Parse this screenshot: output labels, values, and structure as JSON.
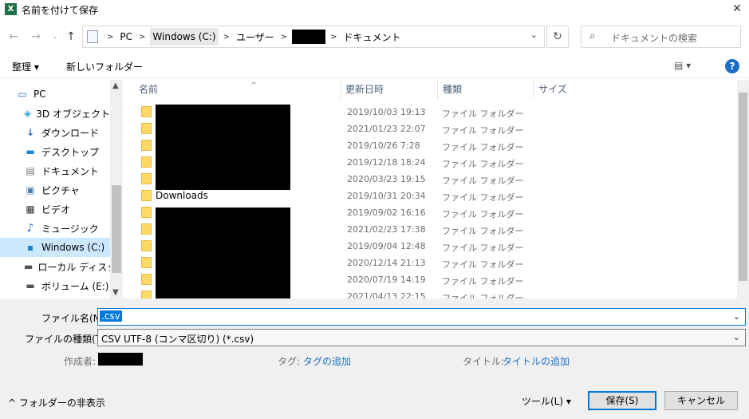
{
  "window": {
    "title": "名前を付けて保存",
    "app_icon_letter": "X",
    "close": "✕"
  },
  "nav": {
    "back": "←",
    "forward": "→",
    "recent": "⌄",
    "up": "↑",
    "refresh": "↻",
    "dropdown": "⌄"
  },
  "breadcrumbs": [
    "PC",
    "Windows (C:)",
    "ユーザー",
    "ドキュメント"
  ],
  "search": {
    "placeholder": "ドキュメントの検索",
    "icon": "⌕"
  },
  "toolbar": {
    "organize": "整理 ▾",
    "new_folder": "新しいフォルダー",
    "view": "▤ ▾",
    "help": "?"
  },
  "sidebar": {
    "items": [
      {
        "label": "PC",
        "icon": "pc-icon",
        "glyph": "▭"
      },
      {
        "label": "3D オブジェクト",
        "icon": "3d-objects-icon",
        "glyph": "◈"
      },
      {
        "label": "ダウンロード",
        "icon": "download-icon",
        "glyph": "↓"
      },
      {
        "label": "デスクトップ",
        "icon": "desktop-icon",
        "glyph": "▬"
      },
      {
        "label": "ドキュメント",
        "icon": "documents-icon",
        "glyph": "▤"
      },
      {
        "label": "ピクチャ",
        "icon": "pictures-icon",
        "glyph": "▣"
      },
      {
        "label": "ビデオ",
        "icon": "videos-icon",
        "glyph": "▦"
      },
      {
        "label": "ミュージック",
        "icon": "music-icon",
        "glyph": "♪"
      },
      {
        "label": "Windows (C:)",
        "icon": "drive-icon",
        "glyph": "▪"
      },
      {
        "label": "ローカル ディスク (D",
        "icon": "drive-icon",
        "glyph": "▬"
      },
      {
        "label": "ボリューム (E:)",
        "icon": "drive-icon",
        "glyph": "▬"
      }
    ],
    "selected_index": 8
  },
  "columns": {
    "name": "名前",
    "date": "更新日時",
    "type": "種類",
    "size": "サイズ"
  },
  "files": [
    {
      "name": "",
      "date": "2019/10/03 19:13",
      "type": "ファイル フォルダー"
    },
    {
      "name": "",
      "date": "2021/01/23 22:07",
      "type": "ファイル フォルダー"
    },
    {
      "name": "",
      "date": "2019/10/26 7:28",
      "type": "ファイル フォルダー"
    },
    {
      "name": "",
      "date": "2019/12/18 18:24",
      "type": "ファイル フォルダー"
    },
    {
      "name": "",
      "date": "2020/03/23 19:15",
      "type": "ファイル フォルダー"
    },
    {
      "name": "Downloads",
      "date": "2019/10/31 20:34",
      "type": "ファイル フォルダー"
    },
    {
      "name": "",
      "date": "2019/09/02 16:16",
      "type": "ファイル フォルダー"
    },
    {
      "name": "",
      "date": "2021/02/23 17:38",
      "type": "ファイル フォルダー"
    },
    {
      "name": "",
      "date": "2019/09/04 12:48",
      "type": "ファイル フォルダー"
    },
    {
      "name": "",
      "date": "2020/12/14 21:13",
      "type": "ファイル フォルダー"
    },
    {
      "name": "",
      "date": "2020/07/19 14:19",
      "type": "ファイル フォルダー"
    },
    {
      "name": "",
      "date": "2021/04/13 22:15",
      "type": "ファイル フォルダー"
    }
  ],
  "form": {
    "filename_label": "ファイル名(N):",
    "filename_value": ".csv",
    "filetype_label": "ファイルの種類(T):",
    "filetype_value": "CSV UTF-8 (コンマ区切り) (*.csv)",
    "author_label": "作成者:",
    "tags_label": "タグ:",
    "tags_link": "タグの追加",
    "title_label": "タイトル:",
    "title_link": "タイトルの追加"
  },
  "footer": {
    "hide_folders": "^ フォルダーの非表示",
    "tools": "ツール(L)   ▾",
    "save": "保存(S)",
    "cancel": "キャンセル"
  }
}
